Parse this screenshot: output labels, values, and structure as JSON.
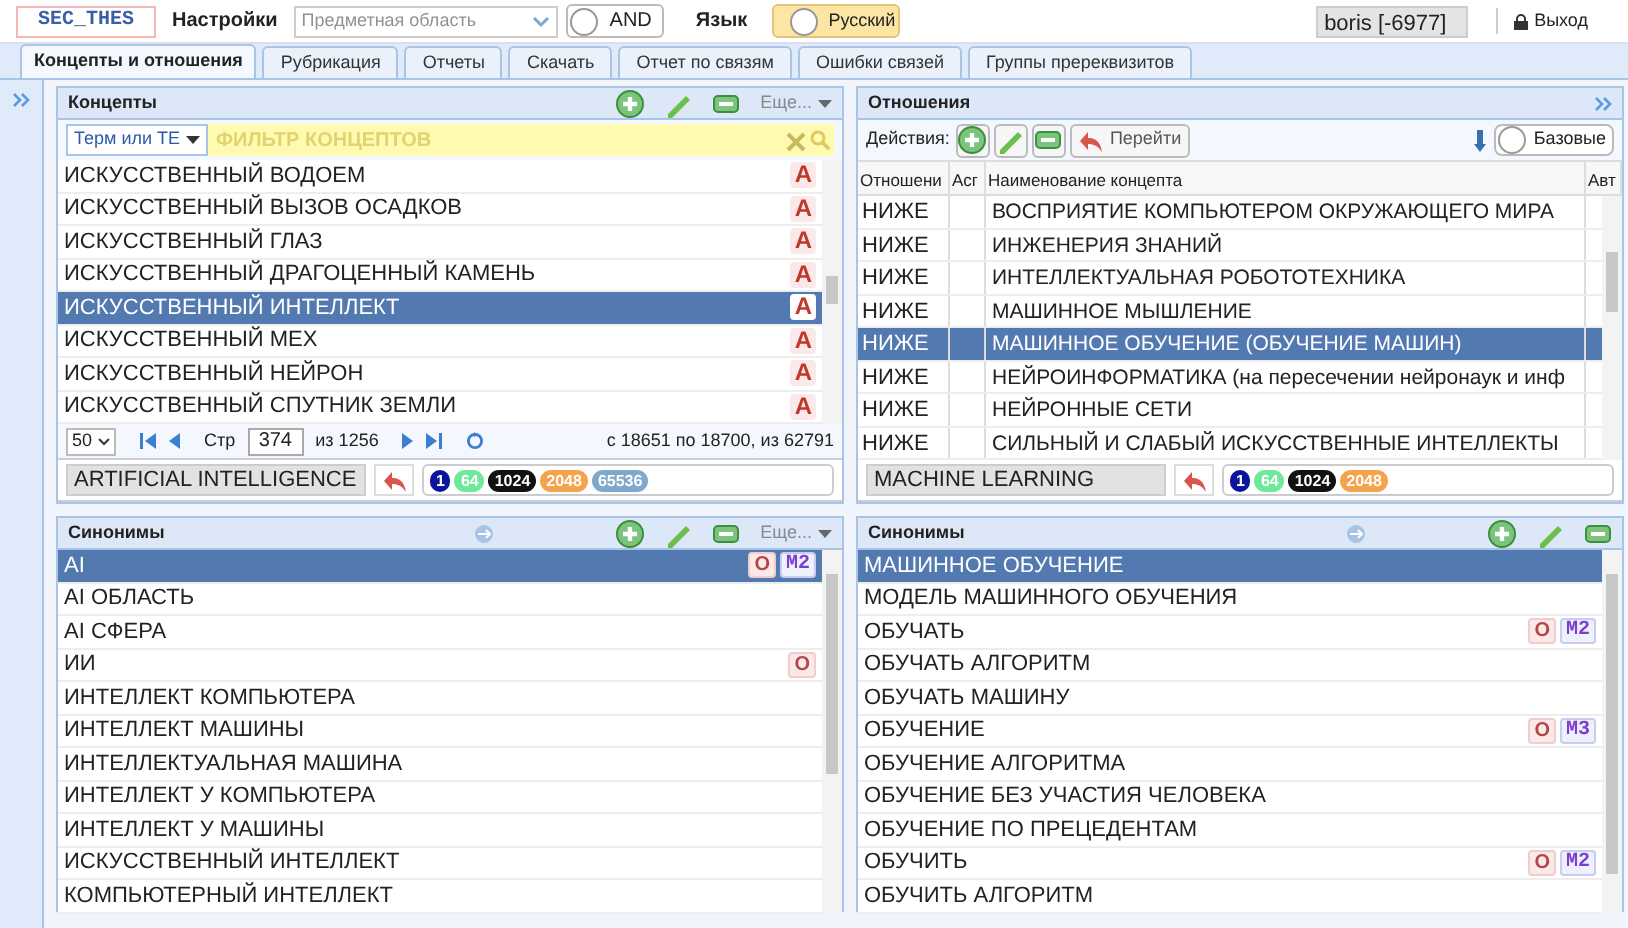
{
  "top_bar": {
    "logo": "SEC_THES",
    "settings": "Настройки",
    "subject_area": {
      "placeholder": "Предметная область"
    },
    "and_toggle": {
      "label": "AND",
      "on": false
    },
    "language_label": "Язык",
    "language_toggle": {
      "label": "Русский",
      "on": false
    },
    "user": "boris [-6977]",
    "logout": "Выход"
  },
  "tabs": [
    {
      "label": "Концепты и отношения",
      "selected": true
    },
    {
      "label": "Рубрикация",
      "selected": false
    },
    {
      "label": "Отчеты",
      "selected": false
    },
    {
      "label": "Скачать",
      "selected": false
    },
    {
      "label": "Отчет по связям",
      "selected": false
    },
    {
      "label": "Ошибки связей",
      "selected": false
    },
    {
      "label": "Группы пререквизитов",
      "selected": false
    }
  ],
  "concepts": {
    "title": "Концепты",
    "more": "Еще...",
    "filter_mode": "Терм или ТЕ",
    "filter": {
      "placeholder": "ФИЛЬТР КОНЦЕПТОВ"
    },
    "rows": [
      {
        "name": "ИСКУССТВЕННЫЙ ВОДОЕМ",
        "badge": "A",
        "selected": false
      },
      {
        "name": "ИСКУССТВЕННЫЙ ВЫЗОВ ОСАДКОВ",
        "badge": "A",
        "selected": false
      },
      {
        "name": "ИСКУССТВЕННЫЙ ГЛАЗ",
        "badge": "A",
        "selected": false
      },
      {
        "name": "ИСКУССТВЕННЫЙ ДРАГОЦЕННЫЙ КАМЕНЬ",
        "badge": "A",
        "selected": false
      },
      {
        "name": "ИСКУССТВЕННЫЙ ИНТЕЛЛЕКТ",
        "badge": "A",
        "selected": true
      },
      {
        "name": "ИСКУССТВЕННЫЙ МЕХ",
        "badge": "A",
        "selected": false
      },
      {
        "name": "ИСКУССТВЕННЫЙ НЕЙРОН",
        "badge": "A",
        "selected": false
      },
      {
        "name": "ИСКУССТВЕННЫЙ СПУТНИК ЗЕМЛИ",
        "badge": "A",
        "selected": false
      }
    ],
    "pager": {
      "page_size": "50",
      "page_label": "Стр",
      "page": "374",
      "of": "из 1256",
      "range": "с 18651 по 18700, из 62791"
    },
    "current": {
      "term": "ARTIFICIAL INTELLIGENCE",
      "tags": [
        {
          "text": "1",
          "color": "#0a14a0"
        },
        {
          "text": "64",
          "color": "#6ee89a"
        },
        {
          "text": "1024",
          "color": "#111111"
        },
        {
          "text": "2048",
          "color": "#f4a24c"
        },
        {
          "text": "65536",
          "color": "#7fa8cc"
        }
      ]
    }
  },
  "concepts_synonyms": {
    "title": "Синонимы",
    "more": "Еще...",
    "rows": [
      {
        "name": "AI",
        "selected": true,
        "marks": [
          {
            "text": "O",
            "kind": "o"
          },
          {
            "text": "M2",
            "kind": "m"
          }
        ]
      },
      {
        "name": "AI ОБЛАСТЬ",
        "selected": false
      },
      {
        "name": "AI СФЕРА",
        "selected": false
      },
      {
        "name": "ИИ",
        "selected": false,
        "marks": [
          {
            "text": "O",
            "kind": "o"
          }
        ]
      },
      {
        "name": "ИНТЕЛЛЕКТ КОМПЬЮТЕРА",
        "selected": false
      },
      {
        "name": "ИНТЕЛЛЕКТ МАШИНЫ",
        "selected": false
      },
      {
        "name": "ИНТЕЛЛЕКТУАЛЬНАЯ МАШИНА",
        "selected": false
      },
      {
        "name": "ИНТЕЛЛЕКТ У КОМПЬЮТЕРА",
        "selected": false
      },
      {
        "name": "ИНТЕЛЛЕКТ У МАШИНЫ",
        "selected": false
      },
      {
        "name": "ИСКУССТВЕННЫЙ ИНТЕЛЛЕКТ",
        "selected": false
      },
      {
        "name": "КОМПЬЮТЕРНЫЙ ИНТЕЛЛЕКТ",
        "selected": false
      }
    ]
  },
  "relations": {
    "title": "Отношения",
    "actions_label": "Действия:",
    "goto": "Перейти",
    "basic_toggle": {
      "label": "Базовые",
      "on": false
    },
    "columns": [
      "Отношени",
      "Асг",
      "Наименование концепта",
      "Авт"
    ],
    "rows": [
      {
        "relation": "НИЖЕ",
        "concept": "ВОСПРИЯТИЕ КОМПЬЮТЕРОМ ОКРУЖАЮЩЕГО МИРА",
        "selected": false
      },
      {
        "relation": "НИЖЕ",
        "concept": "ИНЖЕНЕРИЯ ЗНАНИЙ",
        "selected": false
      },
      {
        "relation": "НИЖЕ",
        "concept": "ИНТЕЛЛЕКТУАЛЬНАЯ РОБОТОТЕХНИКА",
        "selected": false
      },
      {
        "relation": "НИЖЕ",
        "concept": "МАШИННОЕ МЫШЛЕНИЕ",
        "selected": false
      },
      {
        "relation": "НИЖЕ",
        "concept": "МАШИННОЕ ОБУЧЕНИЕ (ОБУЧЕНИЕ МАШИН)",
        "selected": true
      },
      {
        "relation": "НИЖЕ",
        "concept": "НЕЙРОИНФОРМАТИКА (на пересечении нейронаук и инф",
        "selected": false
      },
      {
        "relation": "НИЖЕ",
        "concept": "НЕЙРОННЫЕ СЕТИ",
        "selected": false
      },
      {
        "relation": "НИЖЕ",
        "concept": "СИЛЬНЫЙ И СЛАБЫЙ ИСКУССТВЕННЫЕ ИНТЕЛЛЕКТЫ",
        "selected": false
      }
    ],
    "current": {
      "term": "MACHINE LEARNING",
      "tags": [
        {
          "text": "1",
          "color": "#0a14a0"
        },
        {
          "text": "64",
          "color": "#6ee89a"
        },
        {
          "text": "1024",
          "color": "#111111"
        },
        {
          "text": "2048",
          "color": "#f4a24c"
        }
      ]
    }
  },
  "relations_synonyms": {
    "title": "Синонимы",
    "rows": [
      {
        "name": "МАШИННОЕ ОБУЧЕНИЕ",
        "selected": true
      },
      {
        "name": "МОДЕЛЬ МАШИННОГО ОБУЧЕНИЯ",
        "selected": false
      },
      {
        "name": "ОБУЧАТЬ",
        "selected": false,
        "marks": [
          {
            "text": "O",
            "kind": "o"
          },
          {
            "text": "M2",
            "kind": "m"
          }
        ]
      },
      {
        "name": "ОБУЧАТЬ АЛГОРИТМ",
        "selected": false
      },
      {
        "name": "ОБУЧАТЬ МАШИНУ",
        "selected": false
      },
      {
        "name": "ОБУЧЕНИЕ",
        "selected": false,
        "marks": [
          {
            "text": "O",
            "kind": "o"
          },
          {
            "text": "M3",
            "kind": "m"
          }
        ]
      },
      {
        "name": "ОБУЧЕНИЕ АЛГОРИТМА",
        "selected": false
      },
      {
        "name": "ОБУЧЕНИЕ БЕЗ УЧАСТИЯ ЧЕЛОВЕКА",
        "selected": false
      },
      {
        "name": "ОБУЧЕНИЕ ПО ПРЕЦЕДЕНТАМ",
        "selected": false
      },
      {
        "name": "ОБУЧИТЬ",
        "selected": false,
        "marks": [
          {
            "text": "O",
            "kind": "o"
          },
          {
            "text": "M2",
            "kind": "m"
          }
        ]
      },
      {
        "name": "ОБУЧИТЬ АЛГОРИТМ",
        "selected": false
      }
    ]
  }
}
